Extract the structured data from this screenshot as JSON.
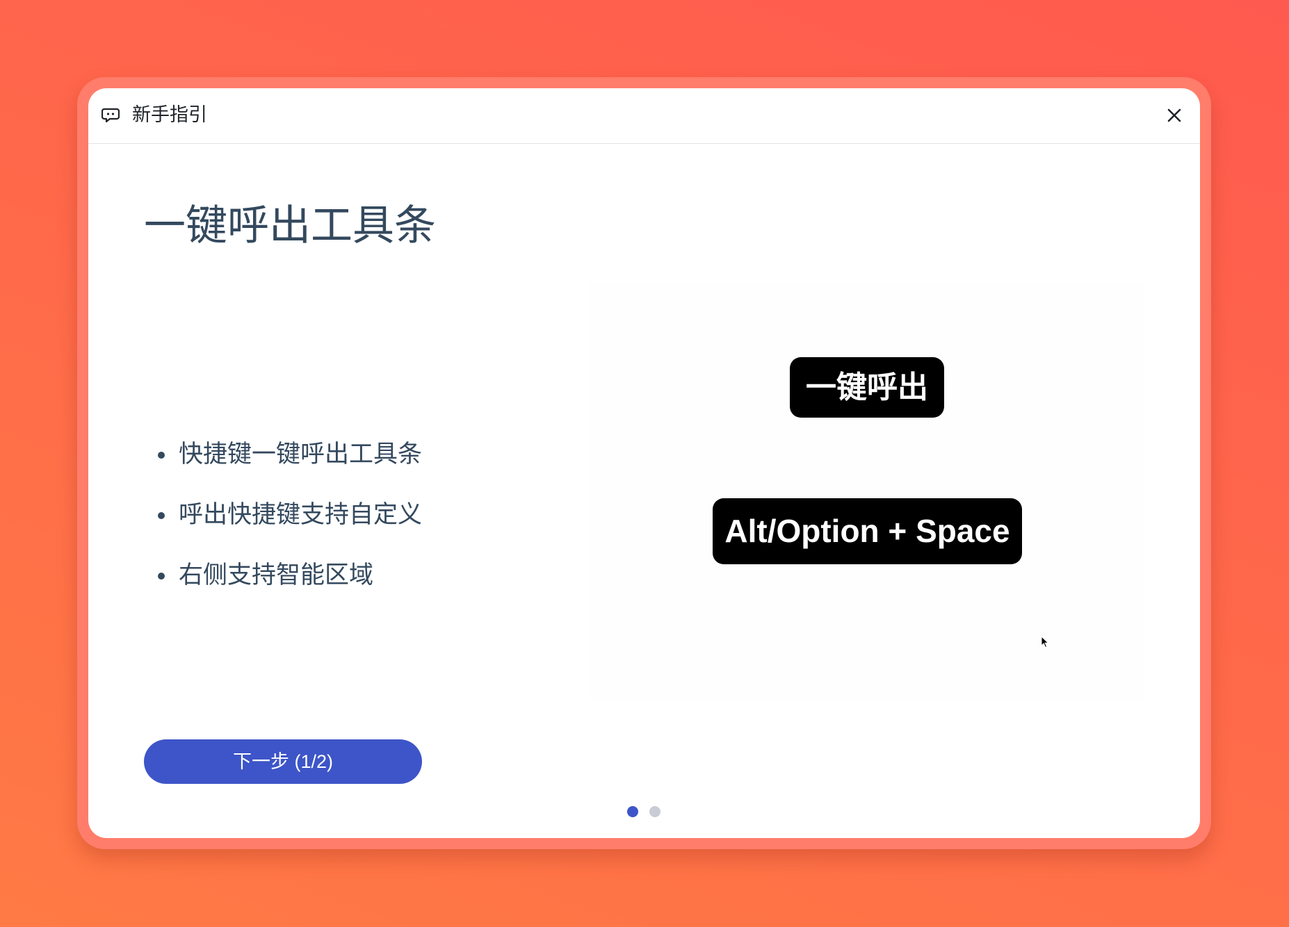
{
  "colors": {
    "background_start": "#ff5a4f",
    "background_end": "#ff7a45",
    "accent": "#3d55c8",
    "text_primary": "#34495e",
    "key_pill_bg": "#000000",
    "dot_active": "#3d55c8",
    "dot_inactive": "#c9ccd4"
  },
  "dialog": {
    "title": "新手指引",
    "title_icon": "chat-bubble-icon",
    "close_icon": "close-icon"
  },
  "slide": {
    "heading": "一键呼出工具条",
    "features": [
      "快捷键一键呼出工具条",
      "呼出快捷键支持自定义",
      "右侧支持智能区域"
    ],
    "preview": {
      "pill_primary": "一键呼出",
      "pill_shortcut": "Alt/Option + Space",
      "cursor_icon": "mouse-cursor-icon"
    }
  },
  "footer": {
    "next_label": "下一步 (1/2)",
    "pagination": {
      "current": 1,
      "total": 2
    }
  }
}
